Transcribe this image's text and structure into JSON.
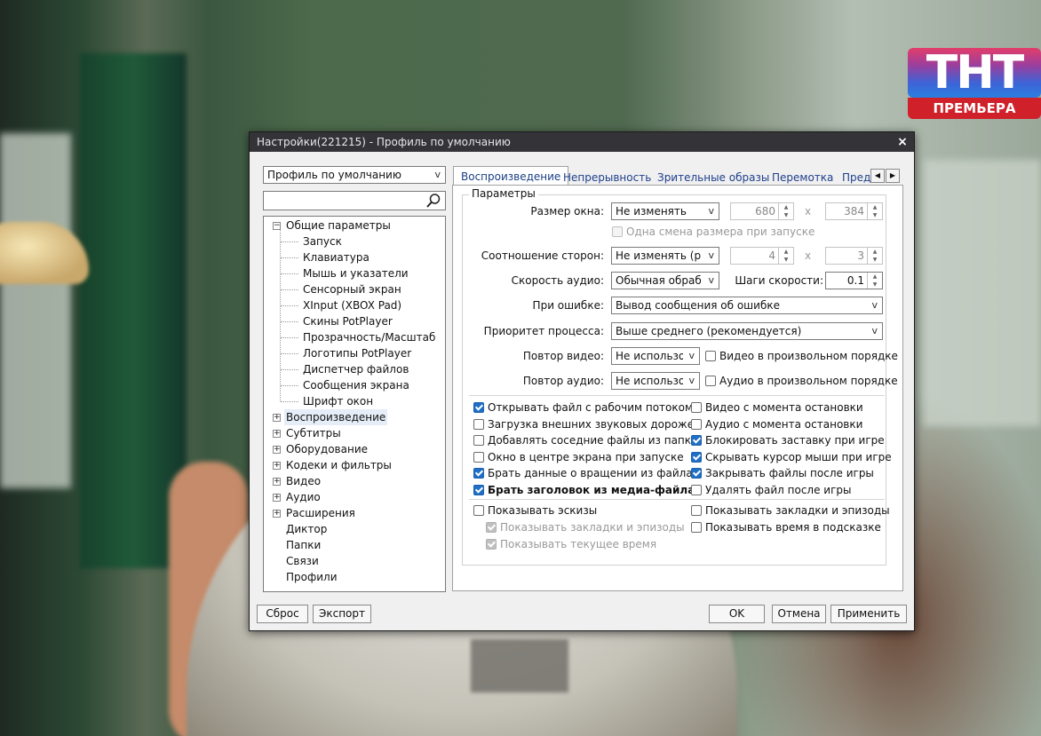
{
  "background": {
    "channel_logo": {
      "letters": "ТНТ",
      "subtitle": "ПРЕМЬЕРА"
    }
  },
  "dialog": {
    "title": "Настройки(221215) - Профиль по умолчанию",
    "close": "×",
    "profile_select": "Профиль по умолчанию",
    "search_placeholder": "",
    "tree": [
      {
        "label": "Общие параметры",
        "level": 0,
        "expander": "−"
      },
      {
        "label": "Запуск",
        "level": 1
      },
      {
        "label": "Клавиатура",
        "level": 1
      },
      {
        "label": "Мышь и указатели",
        "level": 1
      },
      {
        "label": "Сенсорный экран",
        "level": 1
      },
      {
        "label": "XInput (XBOX Pad)",
        "level": 1
      },
      {
        "label": "Скины PotPlayer",
        "level": 1
      },
      {
        "label": "Прозрачность/Масштаб",
        "level": 1
      },
      {
        "label": "Логотипы PotPlayer",
        "level": 1
      },
      {
        "label": "Диспетчер файлов",
        "level": 1
      },
      {
        "label": "Сообщения экрана",
        "level": 1
      },
      {
        "label": "Шрифт окон",
        "level": 1
      },
      {
        "label": "Воспроизведение",
        "level": 0,
        "expander": "+",
        "selected": true
      },
      {
        "label": "Субтитры",
        "level": 0,
        "expander": "+"
      },
      {
        "label": "Оборудование",
        "level": 0,
        "expander": "+"
      },
      {
        "label": "Кодеки и фильтры",
        "level": 0,
        "expander": "+"
      },
      {
        "label": "Видео",
        "level": 0,
        "expander": "+"
      },
      {
        "label": "Аудио",
        "level": 0,
        "expander": "+"
      },
      {
        "label": "Расширения",
        "level": 0,
        "expander": "+"
      },
      {
        "label": "Диктор",
        "level": 0
      },
      {
        "label": "Папки",
        "level": 0
      },
      {
        "label": "Связи",
        "level": 0
      },
      {
        "label": "Профили",
        "level": 0
      }
    ],
    "tabs": [
      "Воспроизведение",
      "Непрерывность",
      "Зрительные образы",
      "Перемотка",
      "Пред"
    ],
    "active_tab": "Воспроизведение",
    "group_title": "Параметры",
    "window_size": {
      "label": "Размер окна:",
      "value": "Не изменять",
      "width": "680",
      "height": "384",
      "x": "x"
    },
    "single_resize": {
      "label": "Одна смена размера при запуске",
      "checked": false,
      "disabled": true
    },
    "aspect": {
      "label": "Соотношение сторон:",
      "value": "Не изменять (рек",
      "a": "4",
      "b": "3",
      "x": "x"
    },
    "audio_speed": {
      "label": "Скорость аудио:",
      "value": "Обычная обрабс",
      "step_label": "Шаги скорости:",
      "step": "0.1"
    },
    "on_error": {
      "label": "При ошибке:",
      "value": "Вывод сообщения об ошибке"
    },
    "priority": {
      "label": "Приоритет процесса:",
      "value": "Выше среднего (рекомендуется)"
    },
    "repeat_video": {
      "label": "Повтор видео:",
      "value": "Не использо",
      "shuffle": "Видео в произвольном порядке",
      "shuffle_checked": false
    },
    "repeat_audio": {
      "label": "Повтор аудио:",
      "value": "Не использо",
      "shuffle": "Аудио в произвольном порядке",
      "shuffle_checked": false
    },
    "options_left": [
      {
        "label": "Открывать файл с рабочим потоком",
        "checked": true
      },
      {
        "label": "Загрузка внешних звуковых дорожек",
        "checked": false
      },
      {
        "label": "Добавлять соседние файлы из папки",
        "checked": false
      },
      {
        "label": "Окно в центре экрана при запуске",
        "checked": false
      },
      {
        "label": "Брать данные о вращении из файла",
        "checked": true
      },
      {
        "label": "Брать заголовок из медиа-файла",
        "checked": true,
        "bold": true
      }
    ],
    "options_right": [
      {
        "label": "Видео с момента остановки",
        "checked": false
      },
      {
        "label": "Аудио с момента остановки",
        "checked": false
      },
      {
        "label": "Блокировать заставку при игре",
        "checked": true
      },
      {
        "label": "Скрывать курсор мыши при игре",
        "checked": true
      },
      {
        "label": "Закрывать файлы после игры",
        "checked": true
      },
      {
        "label": "Удалять файл после игры",
        "checked": false
      }
    ],
    "thumbs": {
      "label": "Показывать эскизы",
      "checked": false
    },
    "thumbs_sub": [
      {
        "label": "Показывать закладки и эпизоды",
        "checked": true,
        "disabled": true
      },
      {
        "label": "Показывать текущее время",
        "checked": true,
        "disabled": true
      }
    ],
    "bookmarks": {
      "label": "Показывать закладки и эпизоды",
      "checked": false
    },
    "tooltip_time": {
      "label": "Показывать время в подсказке",
      "checked": false
    },
    "buttons": {
      "reset": "Сброс",
      "export": "Экспорт",
      "ok": "OK",
      "cancel": "Отмена",
      "apply": "Применить"
    },
    "tab_scroll": {
      "left": "◀",
      "right": "▶"
    }
  },
  "colors": {
    "titlebar": "#333338",
    "checkbox_checked": "#1f6fc5",
    "tab_text": "#1f3f8c"
  },
  "icons": [
    "close-icon",
    "search-icon",
    "chevron-down-icon",
    "expand-icon",
    "collapse-icon"
  ]
}
